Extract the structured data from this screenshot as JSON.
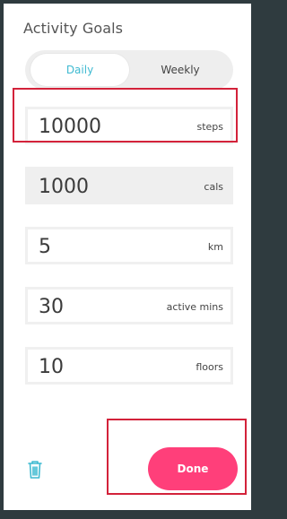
{
  "title": "Activity Goals",
  "tabs": {
    "daily": "Daily",
    "weekly": "Weekly"
  },
  "goals": [
    {
      "value": "10000",
      "unit": "steps"
    },
    {
      "value": "1000",
      "unit": "cals"
    },
    {
      "value": "5",
      "unit": "km"
    },
    {
      "value": "30",
      "unit": "active mins"
    },
    {
      "value": "10",
      "unit": "floors"
    }
  ],
  "done_label": "Done",
  "icons": {
    "delete": "trash-icon"
  },
  "colors": {
    "accent": "#3fbad1",
    "done_button": "#ff3f7a",
    "highlight": "#d3223a"
  }
}
